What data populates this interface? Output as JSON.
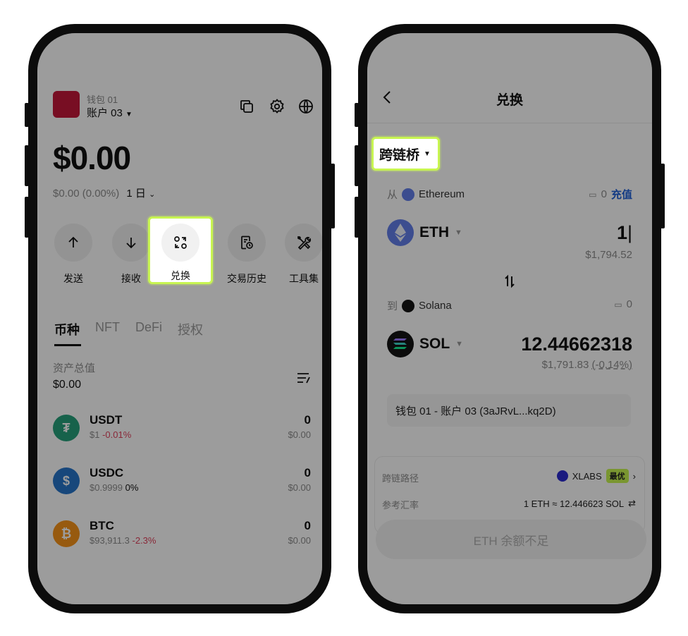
{
  "left": {
    "wallet_name": "钱包 01",
    "account": "账户 03",
    "balance": "$0.00",
    "change": "$0.00 (0.00%)",
    "period": "1 日",
    "actions": [
      {
        "label": "发送",
        "icon": "arrow-up-icon"
      },
      {
        "label": "接收",
        "icon": "arrow-down-icon"
      },
      {
        "label": "兑换",
        "icon": "swap-icon"
      },
      {
        "label": "交易历史",
        "icon": "history-icon"
      },
      {
        "label": "工具集",
        "icon": "tools-icon"
      }
    ],
    "tabs": [
      "币种",
      "NFT",
      "DeFi",
      "授权"
    ],
    "asset_total_label": "资产总值",
    "asset_total": "$0.00",
    "tokens": [
      {
        "symbol": "USDT",
        "price": "$1",
        "change": "-0.01%",
        "amount": "0",
        "value": "$0.00",
        "color": "#26a17b",
        "glyph": "₮"
      },
      {
        "symbol": "USDC",
        "price": "$0.9999",
        "change": "0%",
        "amount": "0",
        "value": "$0.00",
        "color": "#2775ca",
        "glyph": "$"
      },
      {
        "symbol": "BTC",
        "price": "$93,911.3",
        "change": "-2.3%",
        "amount": "0",
        "value": "$0.00",
        "color": "#f7931a",
        "glyph": "₿"
      }
    ]
  },
  "right": {
    "title": "兑换",
    "mode": "跨链桥",
    "from_label": "从",
    "from_chain": "Ethereum",
    "from_balance": "0",
    "deposit": "充值",
    "from_token": "ETH",
    "from_amount": "1",
    "from_usd": "$1,794.52",
    "to_label": "到",
    "to_chain": "Solana",
    "to_balance": "0",
    "to_token": "SOL",
    "to_amount": "12.44662318",
    "to_usd": "$1,791.83",
    "to_diff": "(-0.14%)",
    "address": "钱包 01 - 账户 03 (3aJRvL...kq2D)",
    "route_label": "跨链路径",
    "route_provider": "XLABS",
    "route_badge": "最优",
    "rate_label": "参考汇率",
    "rate": "1 ETH ≈ 12.446623 SOL",
    "cta": "ETH 余额不足"
  },
  "colors": {
    "highlight": "#c8f551",
    "eth": "#627eea",
    "sol": "#141414",
    "link": "#1e5fd8",
    "negative": "#e0445e"
  }
}
